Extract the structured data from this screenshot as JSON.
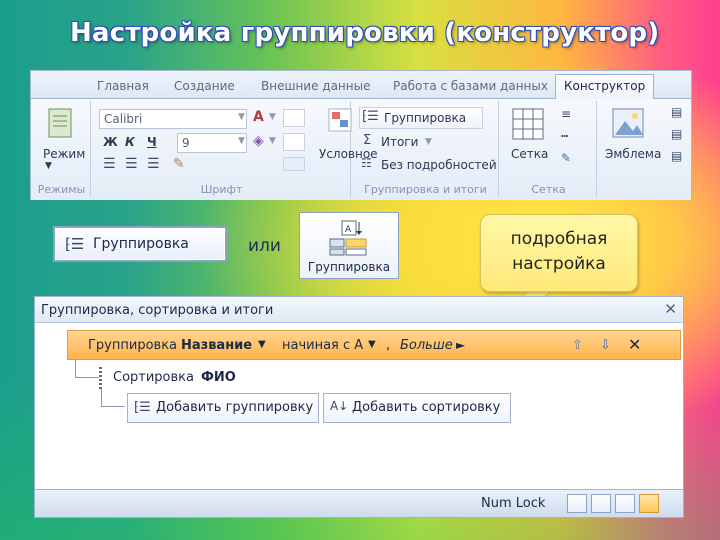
{
  "title": "Настройка группировки (конструктор)",
  "ribbon": {
    "tabs": [
      "Главная",
      "Создание",
      "Внешние данные",
      "Работа с базами данных",
      "Конструктор"
    ],
    "active_tab": "Конструктор",
    "groups": {
      "modes": {
        "label": "Режимы",
        "button": "Режим"
      },
      "font": {
        "label": "Шрифт",
        "font_name": "Calibri",
        "font_size": "9",
        "bold": "Ж",
        "italic": "К",
        "underline": "Ч",
        "conditional": "Условное"
      },
      "grouping": {
        "label": "Группировка и итоги",
        "grouping_btn": "Группировка",
        "totals_btn": "Итоги",
        "details_btn": "Без подробностей"
      },
      "grid": {
        "label": "Сетка",
        "grid_btn": "Сетка"
      },
      "emblem": {
        "label": "",
        "emblem_btn": "Эмблема"
      }
    }
  },
  "standalone": {
    "grouping_button": "Группировка",
    "or_text": "или",
    "icon_button": "Группировка"
  },
  "callout": {
    "line1": "подробная",
    "line2": "настройка"
  },
  "pane": {
    "title": "Группировка, сортировка и итоги",
    "group_row": {
      "prefix": "Группировка",
      "field": "Название",
      "order": "начиная с А",
      "comma": ",",
      "more": "Больше"
    },
    "sort_row": {
      "prefix": "Сортировка",
      "field": "ФИО"
    },
    "add_group": "Добавить группировку",
    "add_sort": "Добавить сортировку",
    "status": "Num Lock"
  },
  "colors": {
    "accent": "#ffb44b",
    "ribbon_border": "#9fb3d1",
    "title_outline": "#2f4fb8"
  }
}
